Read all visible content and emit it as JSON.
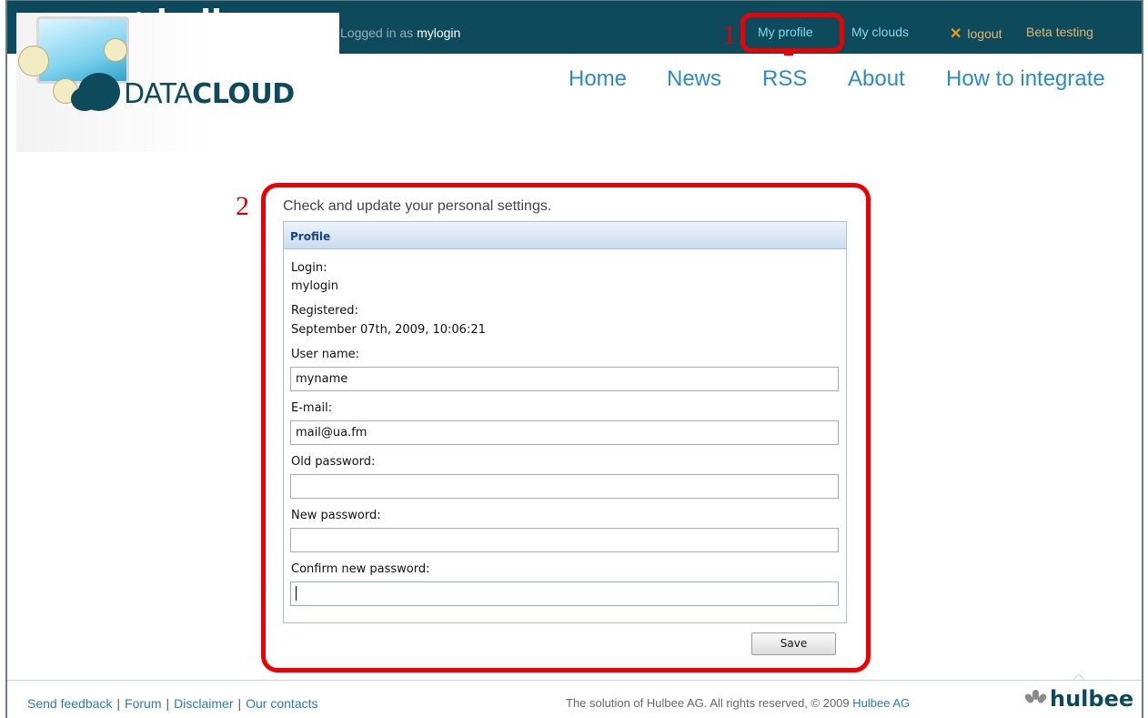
{
  "header": {
    "brand": "hulbee",
    "logged_prefix": "Logged in as",
    "logged_user": "mylogin",
    "links": {
      "my_profile": "My profile",
      "my_clouds": "My clouds",
      "logout": "logout",
      "beta": "Beta testing"
    }
  },
  "logo": {
    "prefix": "DATA",
    "suffix": "CLOUD"
  },
  "nav": {
    "home": "Home",
    "news": "News",
    "rss": "RSS",
    "about": "About",
    "how": "How to integrate"
  },
  "annotations": {
    "one": "1",
    "two": "2"
  },
  "main": {
    "intro": "Check and update your personal settings.",
    "panel_title": "Profile",
    "login_label": "Login:",
    "login_value": "mylogin",
    "registered_label": "Registered:",
    "registered_value": "September 07th, 2009, 10:06:21",
    "username_label": "User name:",
    "username_value": "myname",
    "email_label": "E-mail:",
    "email_value": "mail@ua.fm",
    "old_password_label": "Old password:",
    "new_password_label": "New password:",
    "confirm_password_label": "Confirm new password:",
    "save_label": "Save"
  },
  "footer": {
    "links": [
      "Send feedback",
      "Forum",
      "Disclaimer",
      "Our contacts"
    ],
    "copyright": "The solution of Hulbee AG. All rights reserved, © 2009",
    "company": "Hulbee AG",
    "brand": "hulbee"
  },
  "colors": {
    "topbar": "#0d4a5b",
    "link": "#2a8cc2",
    "accent": "#e3b66a",
    "callout": "#ee0000"
  }
}
